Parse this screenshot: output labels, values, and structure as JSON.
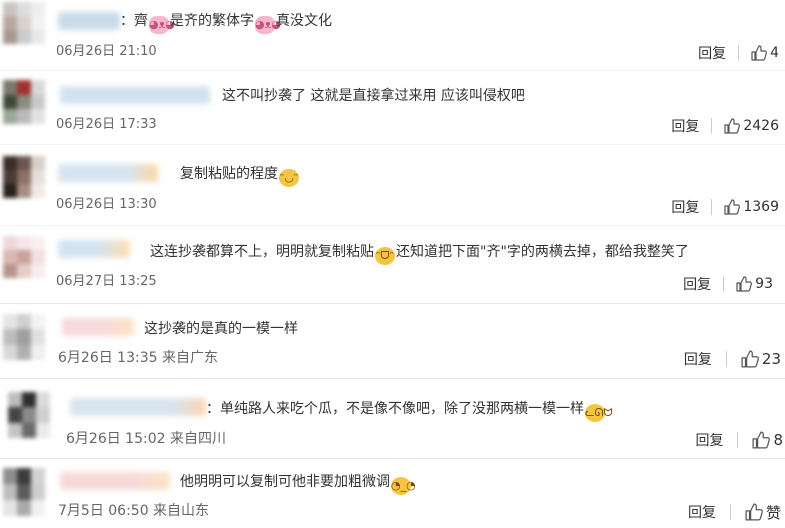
{
  "comments": [
    {
      "text_a": "：齊",
      "text_b": "是齐的繁体字",
      "text_c": "真没文化",
      "emoji_1": "pig-emoji",
      "emoji_2": "pig-emoji",
      "time": "06月26日 21:10",
      "reply": "回复",
      "likes": "4"
    },
    {
      "text_a": "这不叫抄袭了 这就是直接拿过来用 应该叫侵权吧",
      "time": "06月26日 17:33",
      "reply": "回复",
      "likes": "2426"
    },
    {
      "text_a": "复制粘贴的程度",
      "emoji_1": "tongue-emoji",
      "time": "06月26日 13:30",
      "reply": "回复",
      "likes": "1369"
    },
    {
      "text_a": "这连抄袭都算不上，明明就复制粘贴",
      "text_b": "还知道把下面\"齐\"字的两横去掉，都给我整笑了",
      "emoji_1": "grin-emoji",
      "time": "06月27日 13:25",
      "reply": "回复",
      "likes": "93"
    },
    {
      "text_a": "这抄袭的是真的一模一样",
      "time": "6月26日 13:35 来自广东",
      "reply": "回复",
      "likes": "23"
    },
    {
      "text_a": "：单纯路人来吃个瓜，不是像不像吧，除了没那两横一模一样",
      "emoji_1": "cat-emoji",
      "time": "6月26日 15:02 来自四川",
      "reply": "回复",
      "likes": "8"
    },
    {
      "text_a": "他明明可以复制可他非要加粗微调",
      "emoji_1": "rolleyes-emoji",
      "time": "7月5日 06:50 来自山东",
      "reply": "回复",
      "likes": "赞"
    }
  ]
}
